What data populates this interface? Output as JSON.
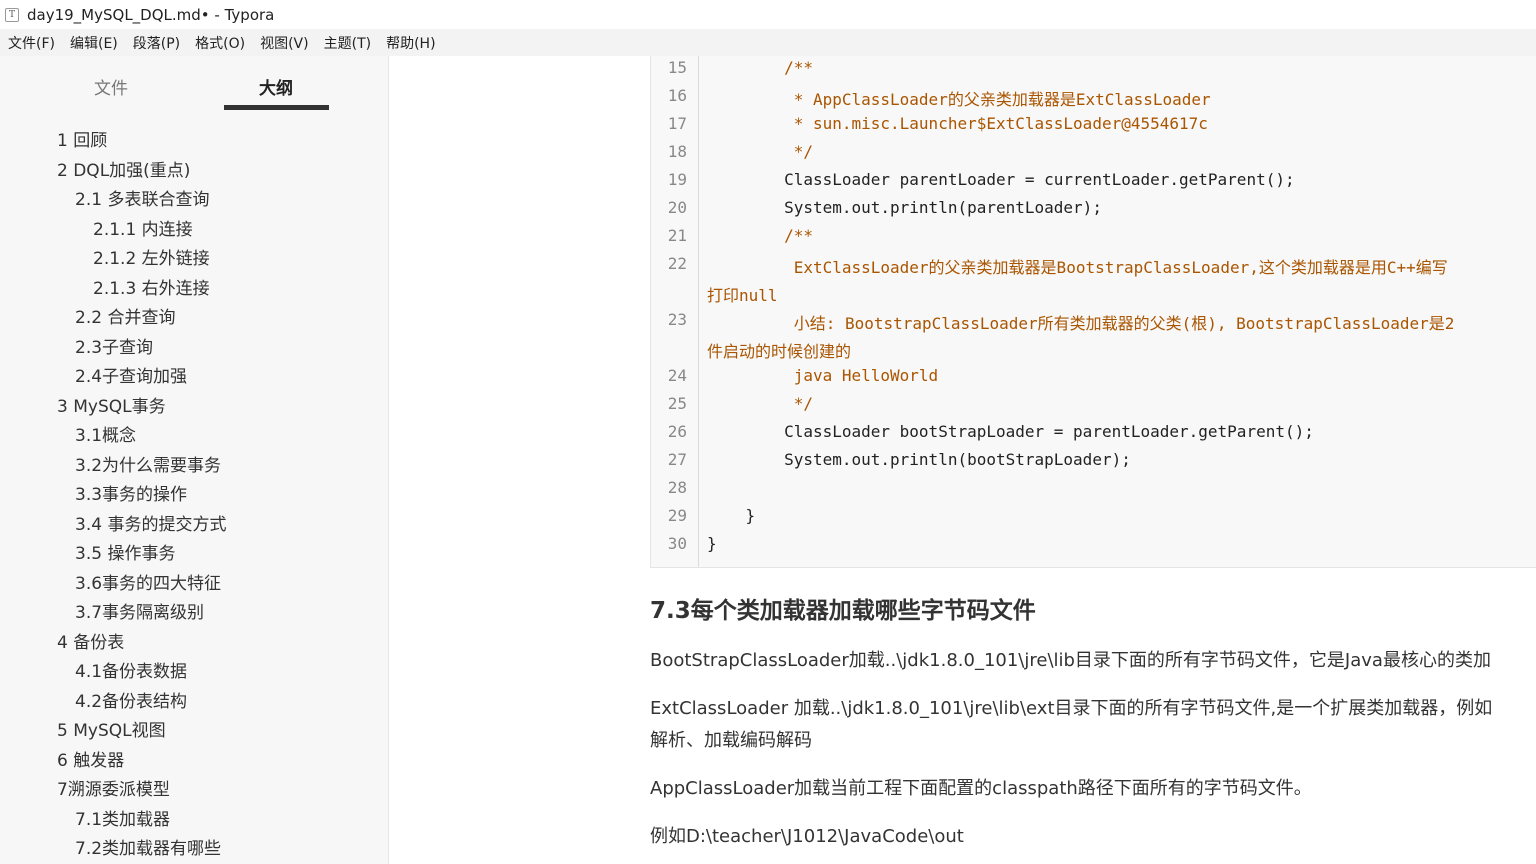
{
  "window": {
    "title": "day19_MySQL_DQL.md• - Typora",
    "icon": "T"
  },
  "menu": [
    "文件(F)",
    "编辑(E)",
    "段落(P)",
    "格式(O)",
    "视图(V)",
    "主题(T)",
    "帮助(H)"
  ],
  "sidebar": {
    "tabs": {
      "files": "文件",
      "outline": "大纲"
    },
    "outline": [
      {
        "label": "1 回顾",
        "level": 1
      },
      {
        "label": "2 DQL加强(重点)",
        "level": 1
      },
      {
        "label": "2.1 多表联合查询",
        "level": 2
      },
      {
        "label": "2.1.1 内连接",
        "level": 3
      },
      {
        "label": "2.1.2 左外链接",
        "level": 3
      },
      {
        "label": "2.1.3 右外连接",
        "level": 3
      },
      {
        "label": "2.2 合并查询",
        "level": 2
      },
      {
        "label": "2.3子查询",
        "level": 2
      },
      {
        "label": "2.4子查询加强",
        "level": 2
      },
      {
        "label": "3 MySQL事务",
        "level": 1
      },
      {
        "label": "3.1概念",
        "level": 2
      },
      {
        "label": "3.2为什么需要事务",
        "level": 2
      },
      {
        "label": "3.3事务的操作",
        "level": 2
      },
      {
        "label": "3.4 事务的提交方式",
        "level": 2
      },
      {
        "label": "3.5 操作事务",
        "level": 2
      },
      {
        "label": "3.6事务的四大特征",
        "level": 2
      },
      {
        "label": "3.7事务隔离级别",
        "level": 2
      },
      {
        "label": "4 备份表",
        "level": 1
      },
      {
        "label": "4.1备份表数据",
        "level": 2
      },
      {
        "label": "4.2备份表结构",
        "level": 2
      },
      {
        "label": "5 MySQL视图",
        "level": 1
      },
      {
        "label": "6 触发器",
        "level": 1
      },
      {
        "label": "7溯源委派模型",
        "level": 1
      },
      {
        "label": "7.1类加载器",
        "level": 2
      },
      {
        "label": "7.2类加载器有哪些",
        "level": 2
      }
    ]
  },
  "code": {
    "line_numbers": [
      "15",
      "16",
      "17",
      "18",
      "19",
      "20",
      "21",
      "22",
      "",
      "23",
      "",
      "24",
      "25",
      "26",
      "27",
      "28",
      "29",
      "30"
    ],
    "lines": [
      "        /**",
      "         * AppClassLoader的父亲类加载器是ExtClassLoader",
      "         * sun.misc.Launcher$ExtClassLoader@4554617c",
      "         */",
      "        ClassLoader parentLoader = currentLoader.getParent();",
      "        System.out.println(parentLoader);",
      "        /**",
      "         ExtClassLoader的父亲类加载器是BootstrapClassLoader,这个类加载器是用C++编写",
      "打印null",
      "         小结: BootstrapClassLoader所有类加载器的父类(根), BootstrapClassLoader是2",
      "件启动的时候创建的",
      "         java HelloWorld",
      "         */",
      "        ClassLoader bootStrapLoader = parentLoader.getParent();",
      "        System.out.println(bootStrapLoader);",
      "",
      "    }",
      "}"
    ]
  },
  "content": {
    "heading": "7.3每个类加载器加载哪些字节码文件",
    "paragraphs": [
      "BootStrapClassLoader加载..\\jdk1.8.0_101\\jre\\lib目录下面的所有字节码文件，它是Java最核心的类加",
      "ExtClassLoader 加载..\\jdk1.8.0_101\\jre\\lib\\ext目录下面的所有字节码文件,是一个扩展类加载器，例如",
      "解析、加载编码解码",
      "AppClassLoader加载当前工程下面配置的classpath路径下面所有的字节码文件。",
      "例如D:\\teacher\\J1012\\JavaCode\\out"
    ]
  },
  "colors": {
    "comment": "#aa5500",
    "code_text": "#222222",
    "operator": "#9933cc",
    "sidebar_bg": "#f7f7f7",
    "menubar_bg": "#f3f3f3",
    "code_bg": "#f8f8f8"
  }
}
